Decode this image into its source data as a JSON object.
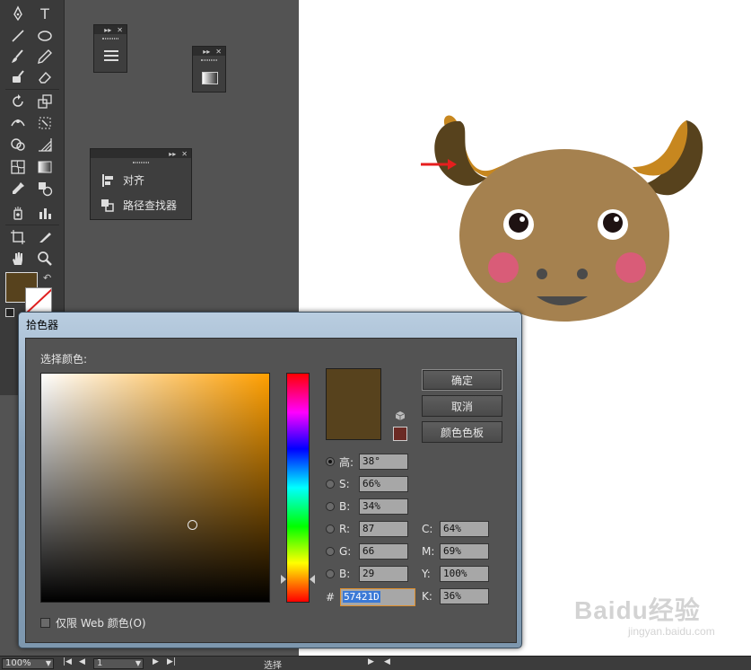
{
  "toolbox": {
    "type_tool_glyph": "T"
  },
  "panels": {
    "align_label": "对齐",
    "pathfinder_label": "路径查找器"
  },
  "color_picker": {
    "title": "拾色器",
    "select_label": "选择颜色:",
    "ok_label": "确定",
    "cancel_label": "取消",
    "swatches_label": "颜色色板",
    "current_color": "#57421D",
    "gamut_color": "#6b2a24",
    "field_marker": {
      "saturation": 0.66,
      "brightness": 0.34
    },
    "hue_fraction": 0.894,
    "hsb": [
      {
        "label": "H:",
        "display_label": "高:",
        "value": "38°",
        "selected": true
      },
      {
        "label": "S:",
        "value": "66%",
        "selected": false
      },
      {
        "label": "B:",
        "value": "34%",
        "selected": false
      }
    ],
    "rgb": [
      {
        "label": "R:",
        "value": "87"
      },
      {
        "label": "G:",
        "value": "66"
      },
      {
        "label": "B:",
        "value": "29"
      }
    ],
    "cmyk": [
      {
        "label": "C:",
        "value": "64%"
      },
      {
        "label": "M:",
        "value": "69%"
      },
      {
        "label": "Y:",
        "value": "100%"
      },
      {
        "label": "K:",
        "value": "36%"
      }
    ],
    "hex_prefix": "#",
    "hex_value": "57421D",
    "web_only_label": "仅限 Web 颜色(O)"
  },
  "statusbar": {
    "zoom": "100%",
    "page": "1",
    "mode": "选择"
  },
  "watermark": {
    "brand": "Baidu经验",
    "url": "jingyan.baidu.com"
  },
  "colors": {
    "fill": "#57421D",
    "horn_dark": "#57421D",
    "horn_light": "#c7871f",
    "face": "#a5814f",
    "cheek": "#d95c78",
    "arrow": "#e61e1e"
  }
}
